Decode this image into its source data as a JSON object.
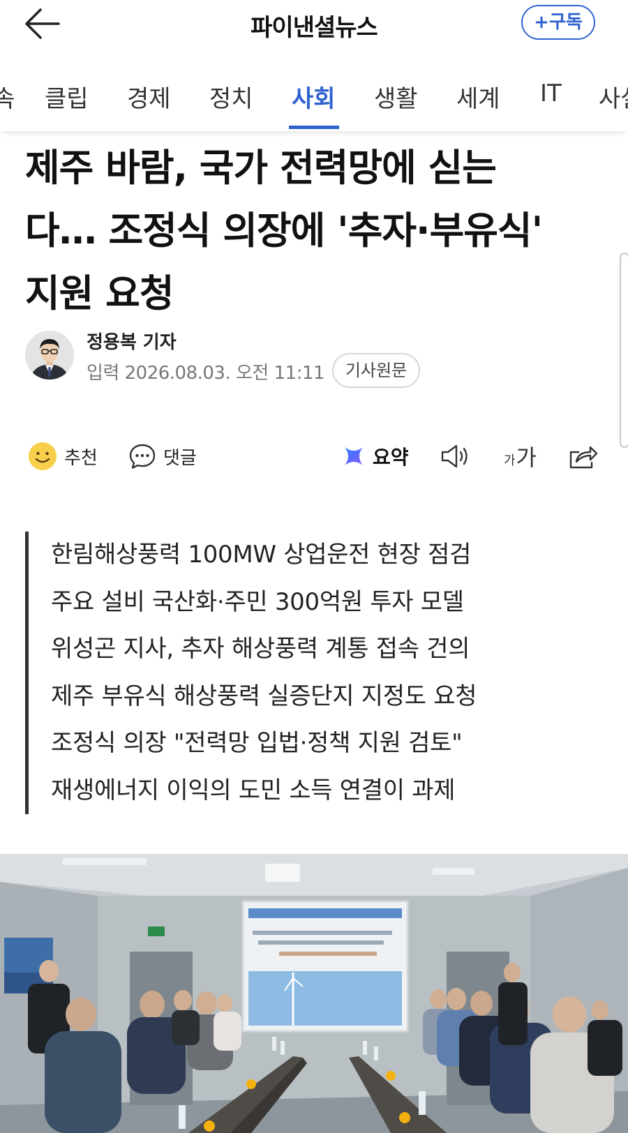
{
  "header": {
    "title": "파이낸셜뉴스",
    "subscribe_label": "+구독"
  },
  "tabs": [
    {
      "label": "속"
    },
    {
      "label": "클립"
    },
    {
      "label": "경제"
    },
    {
      "label": "정치"
    },
    {
      "label": "사회",
      "active": true
    },
    {
      "label": "생활"
    },
    {
      "label": "세계"
    },
    {
      "label": "IT"
    },
    {
      "label": "사설"
    }
  ],
  "article": {
    "headline_lines": [
      "제주 바람, 국가 전력망에 싣는",
      "다… 조정식 의장에 '추자·부유식'",
      "지원 요청"
    ],
    "author": "정용복 기자",
    "dateline": "입력 2026.08.03. 오전 11:11",
    "original_label": "기사원문",
    "summary_lines": [
      "한림해상풍력 100MW 상업운전 현장 점검",
      "주요 설비 국산화·주민 300억원 투자 모델",
      "위성곤 지사, 추자 해상풍력 계통 접속 건의",
      "제주 부유식 해상풍력 실증단지 지정도 요청",
      "조정식 의장 \"전력망 입법·정책 지원 검토\"",
      "재생에너지 이익의 도민 소득 연결이 과제"
    ]
  },
  "actions": {
    "recommend_label": "추천",
    "comment_label": "댓글",
    "summary_label": "요약",
    "font_small": "가",
    "font_large": "가"
  },
  "colors": {
    "accent": "#2f62cf",
    "text": "#111111",
    "muted": "#777777"
  }
}
